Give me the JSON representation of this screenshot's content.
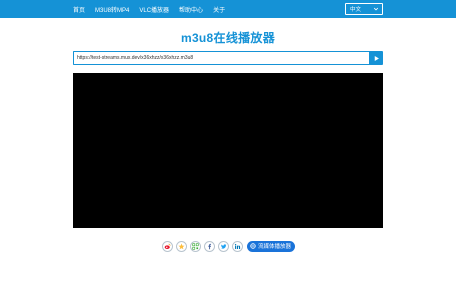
{
  "nav": {
    "items": [
      {
        "label": "首页"
      },
      {
        "label": "M3U8转MP4"
      },
      {
        "label": "VLC播放器"
      },
      {
        "label": "帮助中心"
      },
      {
        "label": "关于"
      }
    ]
  },
  "language": {
    "selected": "中文"
  },
  "page": {
    "title": "m3u8在线播放器"
  },
  "player_form": {
    "url_value": "https://test-streams.mux.dev/x36xhzz/x36xhzz.m3u8"
  },
  "share": {
    "icons": [
      "weibo-icon",
      "qzone-icon",
      "wechat-icon",
      "facebook-icon",
      "twitter-icon",
      "linkedin-icon"
    ],
    "streaming_label": "流媒体播放器"
  },
  "colors": {
    "brand": "#1592d6",
    "player_bg": "#000000",
    "streaming_btn": "#1a73d9"
  }
}
